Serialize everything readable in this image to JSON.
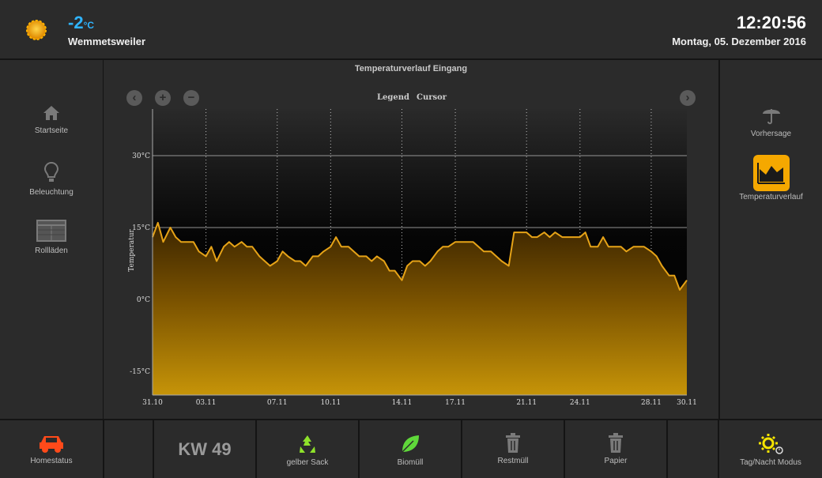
{
  "header": {
    "temperature": "-2",
    "temperature_unit": "°C",
    "location": "Wemmetsweiler",
    "time": "12:20:56",
    "date": "Montag, 05. Dezember 2016"
  },
  "left_nav": [
    {
      "label": "Startseite",
      "icon": "home-icon"
    },
    {
      "label": "Beleuchtung",
      "icon": "lightbulb-icon"
    },
    {
      "label": "Rollläden",
      "icon": "shutter-icon"
    }
  ],
  "right_nav": [
    {
      "label": "Vorhersage",
      "icon": "umbrella-icon"
    },
    {
      "label": "Temperaturverlauf",
      "icon": "area-chart-icon",
      "active": true
    }
  ],
  "chart": {
    "title": "Temperaturverlauf Eingang",
    "legend_label": "Legend",
    "cursor_label": "Cursor",
    "controls": [
      "arrow-left-icon",
      "zoom-in-icon",
      "zoom-out-icon",
      "arrow-right-icon"
    ]
  },
  "chart_data": {
    "type": "area",
    "ylabel": "Temperatur",
    "ylim": [
      -20,
      20
    ],
    "y_ticks": [
      "30°C",
      "15°C",
      "0°C",
      "-15°C"
    ],
    "x_tick_labels": [
      "31.10",
      "03.11",
      "07.11",
      "10.11",
      "14.11",
      "17.11",
      "21.11",
      "24.11",
      "28.11",
      "30.11"
    ],
    "x_tick_days": [
      0,
      3,
      7,
      10,
      14,
      17,
      21,
      24,
      28,
      30
    ],
    "series": [
      {
        "color": "#e6a317",
        "x_days": [
          0,
          0.3,
          0.6,
          1,
          1.3,
          1.6,
          2,
          2.3,
          2.6,
          3,
          3.3,
          3.6,
          4,
          4.3,
          4.6,
          5,
          5.3,
          5.6,
          6,
          6.3,
          6.6,
          7,
          7.3,
          7.6,
          8,
          8.3,
          8.6,
          9,
          9.3,
          9.6,
          10,
          10.3,
          10.6,
          11,
          11.3,
          11.6,
          12,
          12.3,
          12.6,
          13,
          13.3,
          13.6,
          14,
          14.3,
          14.6,
          15,
          15.3,
          15.6,
          16,
          16.3,
          16.6,
          17,
          17.3,
          17.6,
          18,
          18.3,
          18.6,
          19,
          19.3,
          19.6,
          20,
          20.3,
          20.6,
          21,
          21.3,
          21.6,
          22,
          22.3,
          22.6,
          23,
          23.3,
          23.6,
          24,
          24.3,
          24.6,
          25,
          25.3,
          25.6,
          26,
          26.3,
          26.6,
          27,
          27.3,
          27.6,
          28,
          28.3,
          28.6,
          29,
          29.3,
          29.6,
          30
        ],
        "values": [
          13,
          16,
          12,
          15,
          13,
          12,
          12,
          12,
          10,
          9,
          11,
          8,
          11,
          12,
          11,
          12,
          11,
          11,
          9,
          8,
          7,
          8,
          10,
          9,
          8,
          8,
          7,
          9,
          9,
          10,
          11,
          13,
          11,
          11,
          10,
          9,
          9,
          8,
          9,
          8,
          6,
          6,
          4,
          7,
          8,
          8,
          7,
          8,
          10,
          11,
          11,
          12,
          12,
          12,
          12,
          11,
          10,
          10,
          9,
          8,
          7,
          14,
          14,
          14,
          13,
          13,
          14,
          13,
          14,
          13,
          13,
          13,
          13,
          14,
          11,
          11,
          13,
          11,
          11,
          11,
          10,
          11,
          11,
          11,
          10,
          9,
          7,
          5,
          5,
          2,
          4,
          6,
          3
        ]
      }
    ]
  },
  "footer": {
    "homestatus": "Homestatus",
    "kw": "KW 49",
    "gelber_sack": "gelber Sack",
    "biomuell": "Biomüll",
    "restmuell": "Restmüll",
    "papier": "Papier",
    "tag_nacht": "Tag/Nacht Modus"
  },
  "colors": {
    "accent_blue": "#2fb4ff",
    "active_orange": "#f5a800",
    "chart_line": "#e6a317",
    "car_red": "#ff4a1a",
    "recycle_green": "#8ee22a",
    "leaf_green": "#5fd83a"
  }
}
